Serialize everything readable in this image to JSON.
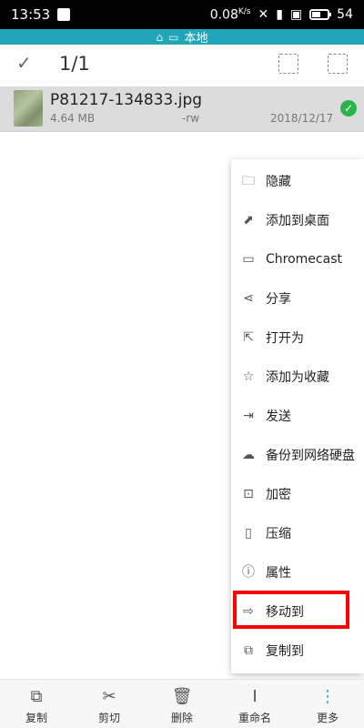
{
  "status_bar": {
    "time": "13:53",
    "speed": "0.08",
    "speed_unit": "K/s",
    "battery": "54"
  },
  "location": {
    "label": "本地"
  },
  "toolbar": {
    "selection_count": "1/1"
  },
  "file": {
    "name": "P81217-134833.jpg",
    "size": "4.64 MB",
    "permissions": "-rw",
    "date": "2018/12/17"
  },
  "context_menu": {
    "items": [
      {
        "label": "隐藏",
        "icon": "hide-icon"
      },
      {
        "label": "添加到桌面",
        "icon": "add-to-desktop-icon"
      },
      {
        "label": "Chromecast",
        "icon": "cast-icon"
      },
      {
        "label": "分享",
        "icon": "share-icon"
      },
      {
        "label": "打开为",
        "icon": "open-as-icon"
      },
      {
        "label": "添加为收藏",
        "icon": "star-icon"
      },
      {
        "label": "发送",
        "icon": "send-icon"
      },
      {
        "label": "备份到网络硬盘",
        "icon": "cloud-backup-icon"
      },
      {
        "label": "加密",
        "icon": "lock-icon"
      },
      {
        "label": "压缩",
        "icon": "zip-icon"
      },
      {
        "label": "属性",
        "icon": "info-icon"
      },
      {
        "label": "移动到",
        "icon": "move-icon"
      },
      {
        "label": "复制到",
        "icon": "copy-to-icon"
      }
    ]
  },
  "bottom_bar": {
    "copy": "复制",
    "cut": "剪切",
    "delete": "删除",
    "rename": "重命名",
    "more": "更多"
  },
  "colors": {
    "accent": "#20a6b8",
    "highlight": "#ff0000",
    "selected_row": "#dcdcdc",
    "check_green": "#2ab54a"
  }
}
